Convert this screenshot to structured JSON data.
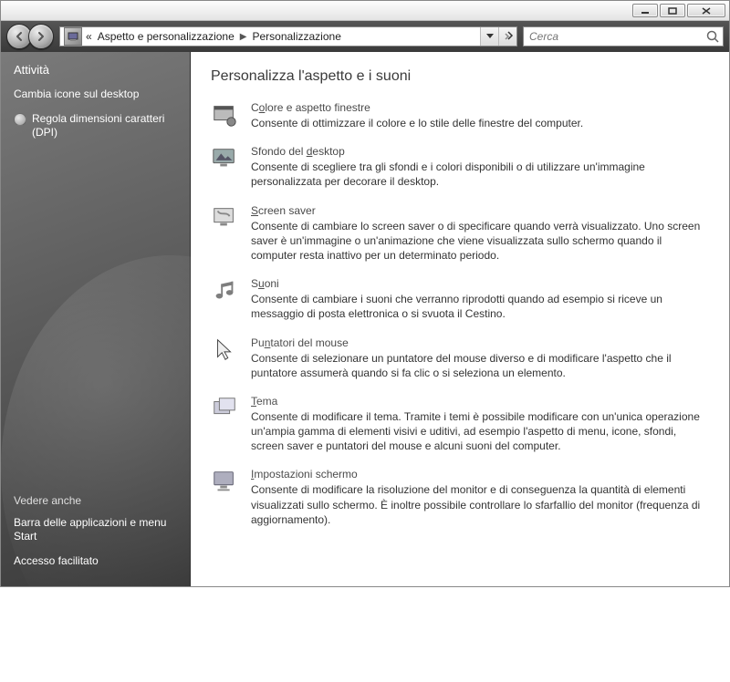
{
  "breadcrumb": {
    "parent": "Aspetto e personalizzazione",
    "current": "Personalizzazione"
  },
  "search": {
    "placeholder": "Cerca"
  },
  "sidebar": {
    "tasks_title": "Attività",
    "links": [
      {
        "label": "Cambia icone sul desktop",
        "globe": false
      },
      {
        "label": "Regola dimensioni caratteri (DPI)",
        "globe": true
      }
    ],
    "seealso_title": "Vedere anche",
    "seealso": [
      {
        "label": "Barra delle applicazioni e menu Start"
      },
      {
        "label": "Accesso facilitato"
      }
    ]
  },
  "content": {
    "heading": "Personalizza l'aspetto e i suoni",
    "items": [
      {
        "title_pre": "C",
        "title_accent": "o",
        "title_post": "lore e aspetto finestre",
        "desc": "Consente di ottimizzare il colore e lo stile delle finestre del computer."
      },
      {
        "title_pre": "Sfondo del ",
        "title_accent": "d",
        "title_post": "esktop",
        "desc": "Consente di scegliere tra gli sfondi e i colori disponibili o di utilizzare un'immagine personalizzata per decorare il desktop."
      },
      {
        "title_pre": "",
        "title_accent": "S",
        "title_post": "creen saver",
        "desc": "Consente di cambiare lo screen saver o di specificare quando verrà visualizzato. Uno screen saver è un'immagine o un'animazione che viene visualizzata sullo schermo quando il computer resta inattivo per un determinato periodo."
      },
      {
        "title_pre": "S",
        "title_accent": "u",
        "title_post": "oni",
        "desc": "Consente di cambiare i suoni che verranno riprodotti quando ad esempio si riceve un messaggio di posta elettronica o si svuota il Cestino."
      },
      {
        "title_pre": "Pu",
        "title_accent": "n",
        "title_post": "tatori del mouse",
        "desc": "Consente di selezionare un puntatore del mouse diverso e di modificare l'aspetto che il puntatore assumerà quando si fa clic o si seleziona un elemento."
      },
      {
        "title_pre": "",
        "title_accent": "T",
        "title_post": "ema",
        "desc": "Consente di modificare il tema. Tramite i temi è possibile modificare con un'unica operazione un'ampia gamma di elementi visivi e uditivi, ad esempio l'aspetto di menu, icone, sfondi, screen saver e puntatori del mouse e alcuni suoni del computer."
      },
      {
        "title_pre": "",
        "title_accent": "I",
        "title_post": "mpostazioni schermo",
        "desc": "Consente di modificare la risoluzione del monitor e di conseguenza la quantità di elementi visualizzati sullo schermo. È inoltre possibile controllare lo sfarfallio del monitor (frequenza di aggiornamento)."
      }
    ]
  }
}
